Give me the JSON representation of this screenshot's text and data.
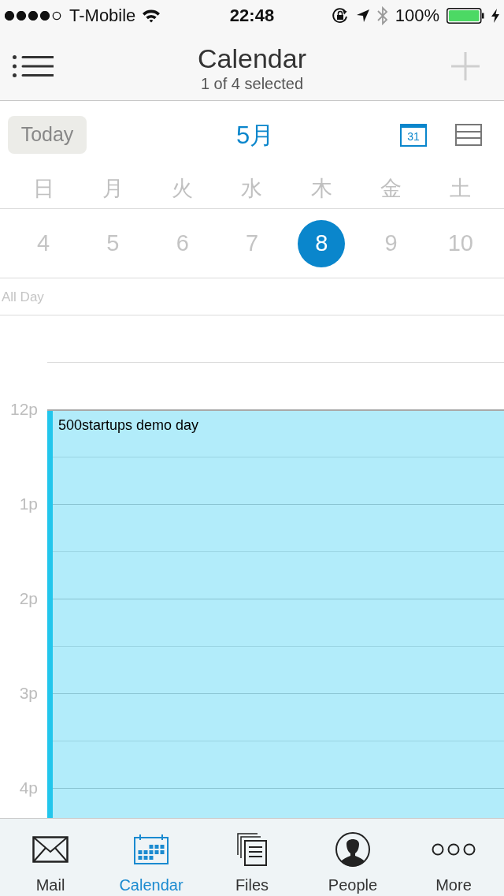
{
  "status_bar": {
    "carrier": "T-Mobile",
    "time": "22:48",
    "battery": "100%"
  },
  "nav_bar": {
    "title": "Calendar",
    "subtitle": "1 of 4 selected"
  },
  "toolbar": {
    "today_button": "Today",
    "month": "5月",
    "view_buttons": [
      {
        "kind": "month",
        "label": "31",
        "selected": true
      },
      {
        "kind": "list",
        "selected": false
      }
    ]
  },
  "week": {
    "weekdays": [
      "日",
      "月",
      "火",
      "水",
      "木",
      "金",
      "土"
    ],
    "dates": [
      {
        "label": "4",
        "selected": false
      },
      {
        "label": "5",
        "selected": false
      },
      {
        "label": "6",
        "selected": false
      },
      {
        "label": "7",
        "selected": false
      },
      {
        "label": "8",
        "selected": true
      },
      {
        "label": "9",
        "selected": false
      },
      {
        "label": "10",
        "selected": false
      }
    ]
  },
  "all_day": {
    "label": "All Day"
  },
  "timeline": {
    "hours": [
      "12p",
      "1p",
      "2p",
      "3p",
      "4p"
    ],
    "events": [
      {
        "title": "500startups demo day"
      }
    ]
  },
  "tab_bar": [
    {
      "kind": "mail",
      "label": "Mail",
      "selected": false
    },
    {
      "kind": "calendar",
      "label": "Calendar",
      "selected": true
    },
    {
      "kind": "files",
      "label": "Files",
      "selected": false
    },
    {
      "kind": "people",
      "label": "People",
      "selected": false
    },
    {
      "kind": "more",
      "label": "More",
      "selected": false
    }
  ]
}
